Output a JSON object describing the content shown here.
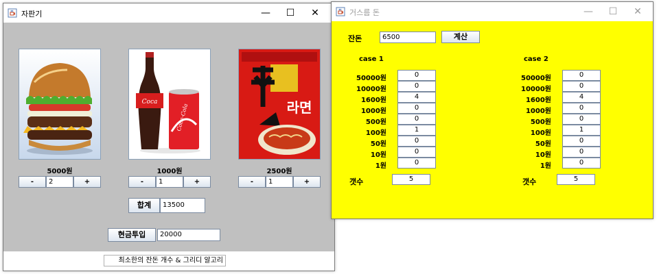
{
  "vending": {
    "title": "자판기",
    "products": [
      {
        "name": "burger",
        "price": "5000원",
        "qty": "2",
        "minus": "-",
        "plus": "+"
      },
      {
        "name": "cola",
        "price": "1000원",
        "qty": "1",
        "minus": "-",
        "plus": "+"
      },
      {
        "name": "ramen",
        "price": "2500원",
        "qty": "1",
        "minus": "-",
        "plus": "+"
      }
    ],
    "total_label": "합계",
    "total_value": "13500",
    "cash_label": "현금투입",
    "cash_value": "20000",
    "footer": "최소한의 잔돈 개수 & 그리디 알고리"
  },
  "change": {
    "title": "거스름 돈",
    "remain_label": "잔돈",
    "remain_value": "6500",
    "calc_label": "계산",
    "cases": [
      {
        "title": "case 1",
        "rows": [
          {
            "label": "50000원",
            "value": "0"
          },
          {
            "label": "10000원",
            "value": "0"
          },
          {
            "label": "1600원",
            "value": "4"
          },
          {
            "label": "1000원",
            "value": "0"
          },
          {
            "label": "500원",
            "value": "0"
          },
          {
            "label": "100원",
            "value": "1"
          },
          {
            "label": "50원",
            "value": "0"
          },
          {
            "label": "10원",
            "value": "0"
          },
          {
            "label": "1원",
            "value": "0"
          }
        ],
        "count_label": "갯수",
        "count_value": "5"
      },
      {
        "title": "case 2",
        "rows": [
          {
            "label": "50000원",
            "value": "0"
          },
          {
            "label": "10000원",
            "value": "0"
          },
          {
            "label": "1600원",
            "value": "4"
          },
          {
            "label": "1000원",
            "value": "0"
          },
          {
            "label": "500원",
            "value": "0"
          },
          {
            "label": "100원",
            "value": "1"
          },
          {
            "label": "50원",
            "value": "0"
          },
          {
            "label": "10원",
            "value": "0"
          },
          {
            "label": "1원",
            "value": "0"
          }
        ],
        "count_label": "갯수",
        "count_value": "5"
      }
    ]
  },
  "colors": {
    "vending_bg": "#c0c0c0",
    "change_bg": "#ffff00"
  },
  "icons": [
    "java-cup-icon",
    "minimize-icon",
    "maximize-icon",
    "close-icon"
  ]
}
